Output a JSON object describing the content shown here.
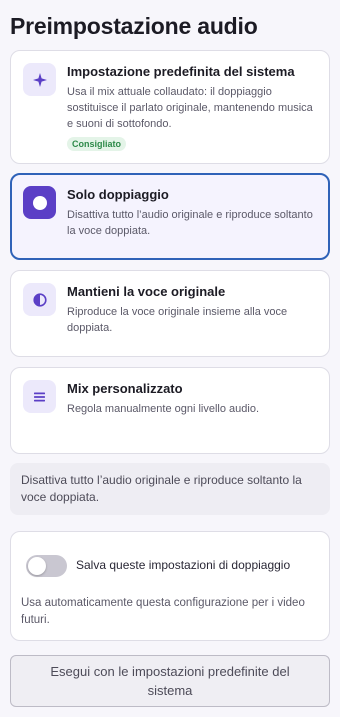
{
  "header": {
    "title": "Preimpostazione audio"
  },
  "options": [
    {
      "title": "Impostazione predefinita del sistema",
      "description": "Usa il mix attuale collaudato: il doppiaggio sostituisce il parlato originale, mantenendo musica e suoni di sottofondo.",
      "badge": "Consigliato",
      "icon": "sparkle-icon",
      "selected": false
    },
    {
      "title": "Solo doppiaggio",
      "description": "Disattiva tutto l’audio originale e riproduce soltanto la voce doppiata.",
      "icon": "circle-icon",
      "selected": true
    },
    {
      "title": "Mantieni la voce originale",
      "description": "Riproduce la voce originale insieme alla voce doppiata.",
      "icon": "half-circle-icon",
      "selected": false
    },
    {
      "title": "Mix personalizzato",
      "description": "Regola manualmente ogni livello audio.",
      "icon": "sliders-icon",
      "selected": false
    }
  ],
  "summary": {
    "text": "Disattiva tutto l’audio originale e riproduce soltanto la voce doppiata."
  },
  "save_settings": {
    "toggle_label": "Salva queste impostazioni di doppiaggio",
    "toggle_on": false,
    "description": "Usa automaticamente questa configurazione per i video futuri."
  },
  "actions": {
    "run_default_label": "Esegui con le impostazioni predefinite del sistema"
  },
  "colors": {
    "accent": "#5b3fc6",
    "selected_border": "#2f62b8",
    "badge_text": "#2e8a4a",
    "badge_bg": "#e4f4e8"
  }
}
